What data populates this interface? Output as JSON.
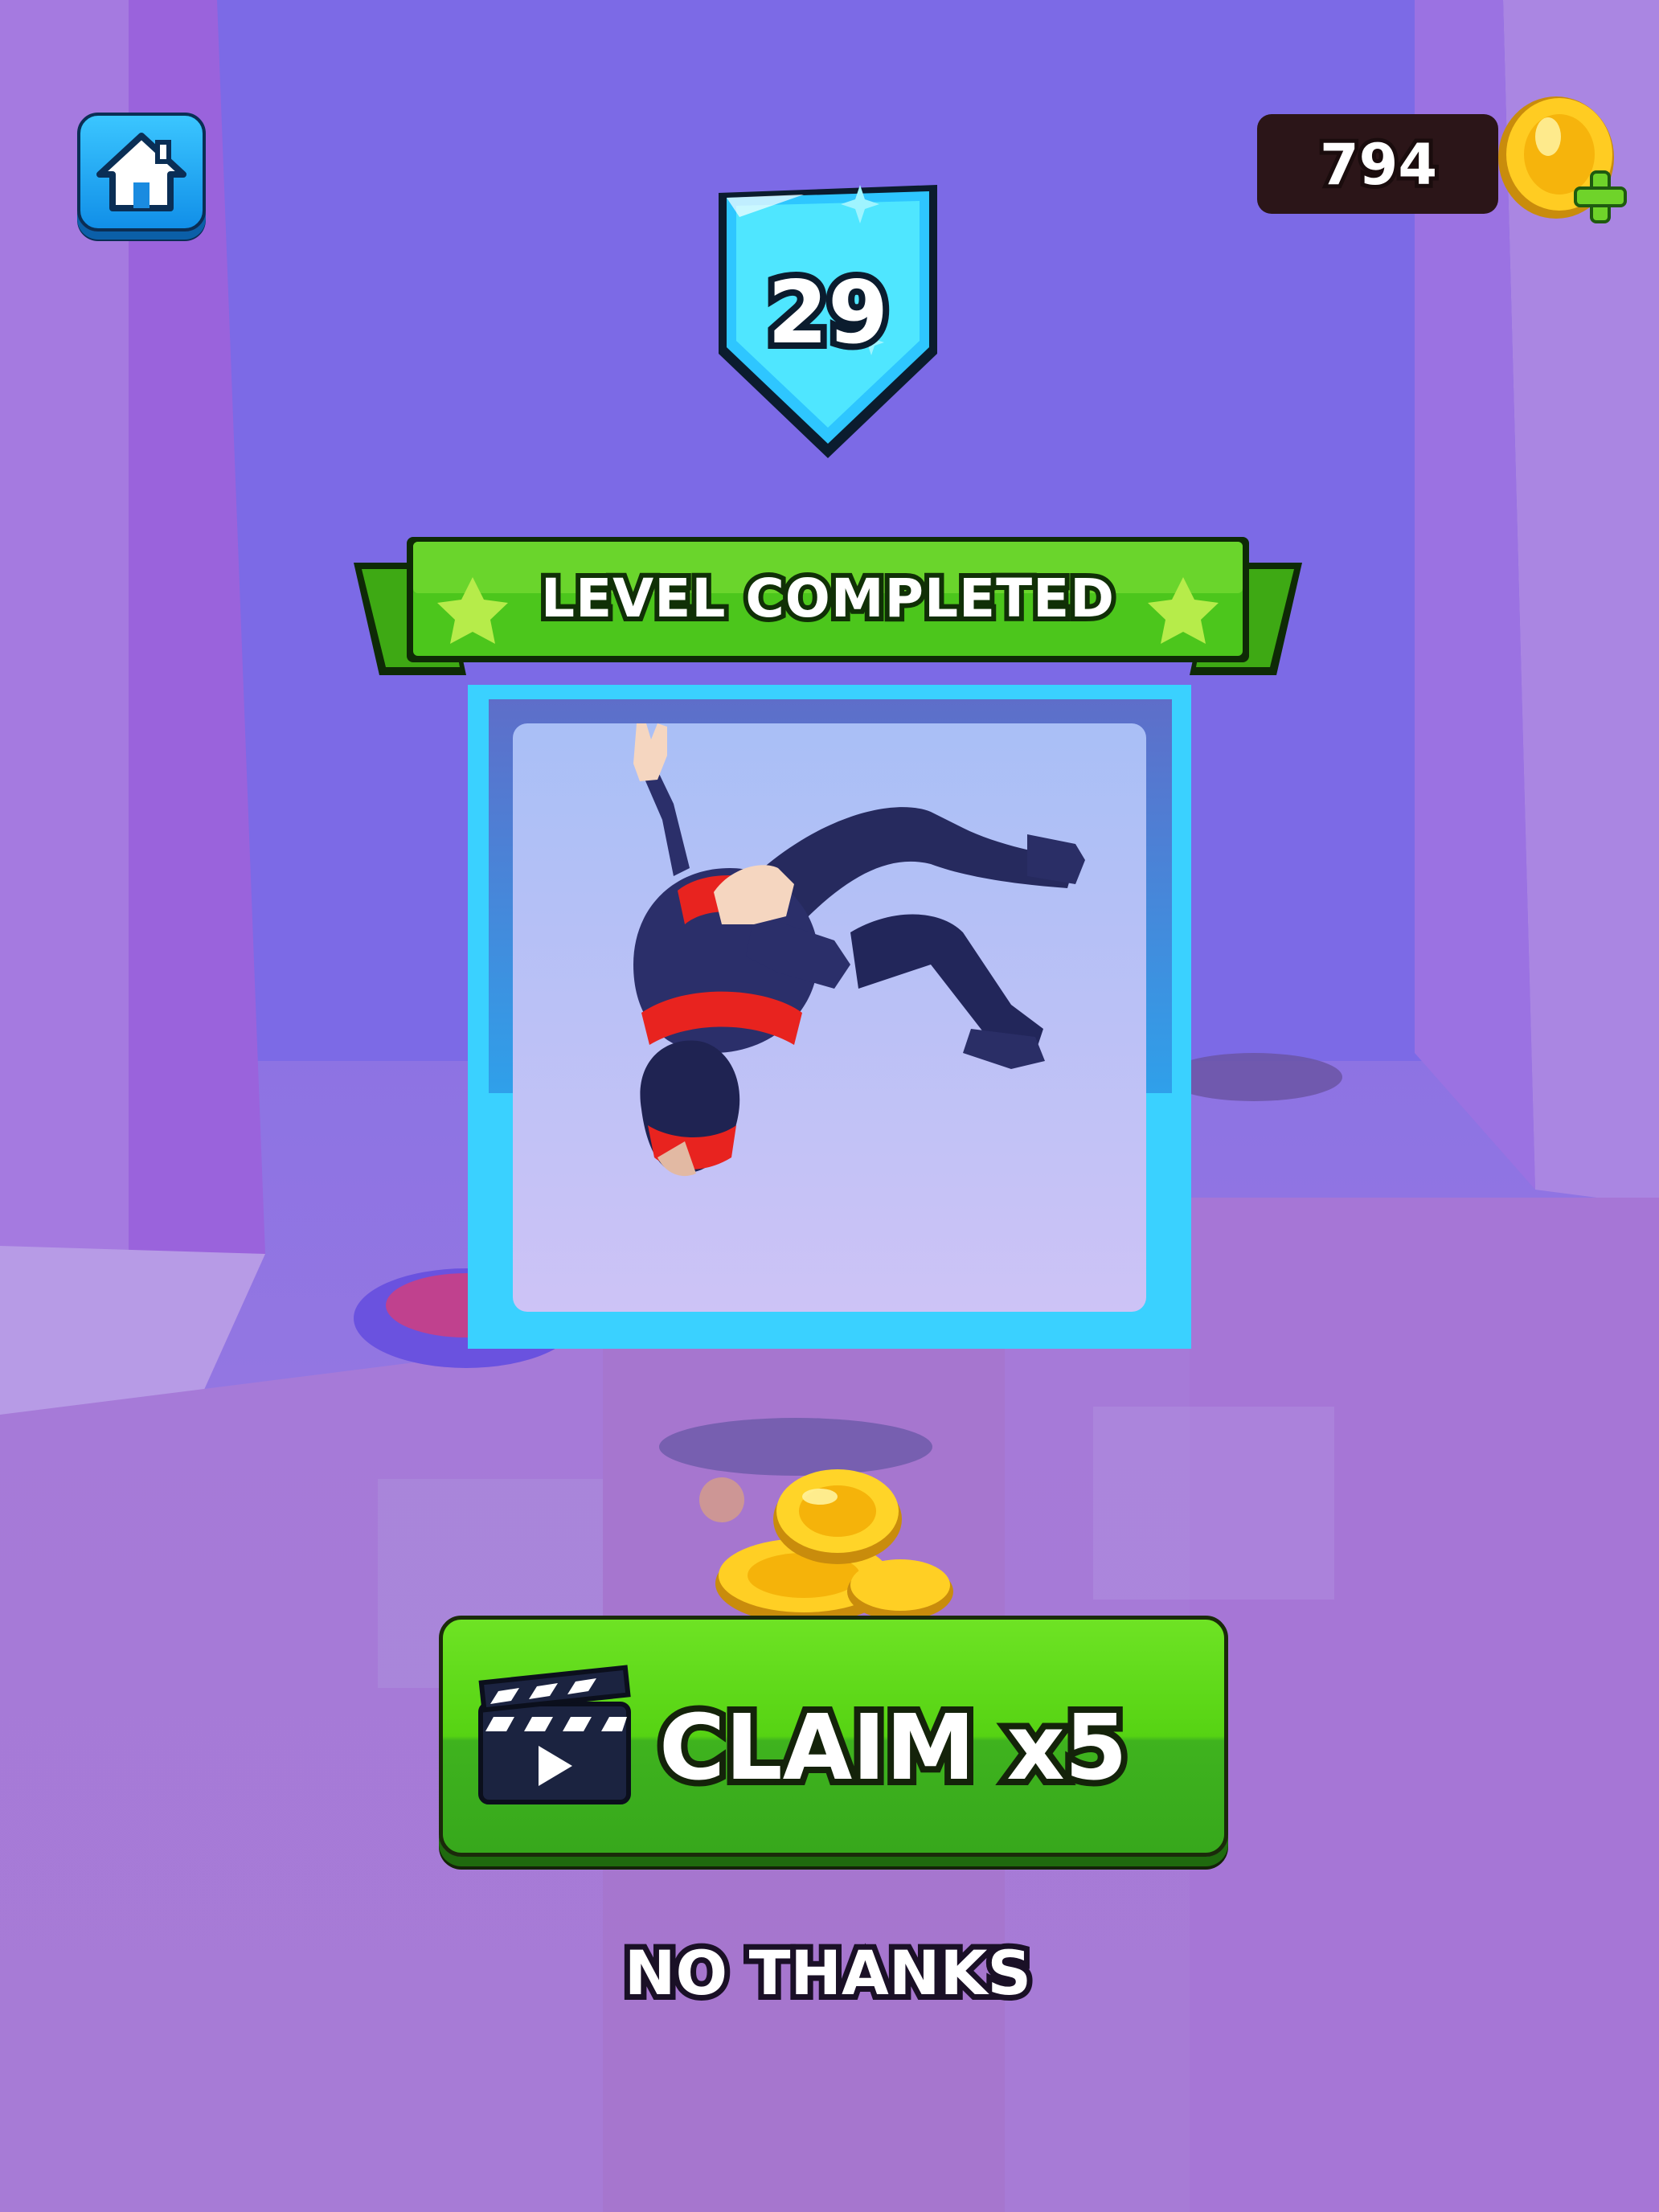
{
  "hud": {
    "coins": "794"
  },
  "level": {
    "number": "29"
  },
  "banner": {
    "title": "LEVEL COMPLETED"
  },
  "actions": {
    "claim_label": "CLAIM x5",
    "skip_label": "NO THANKS"
  },
  "icons": {
    "home": "house-icon",
    "coin": "gold-coin-icon",
    "add": "plus-icon",
    "video": "clapperboard-play-icon",
    "star": "star-icon"
  },
  "colors": {
    "background": "#8f6fe0",
    "banner_green": "#4cc61c",
    "claim_green": "#56d313",
    "shield_cyan": "#3ad1ff",
    "home_blue": "#118fe8",
    "coin_gold": "#ffcc22"
  }
}
